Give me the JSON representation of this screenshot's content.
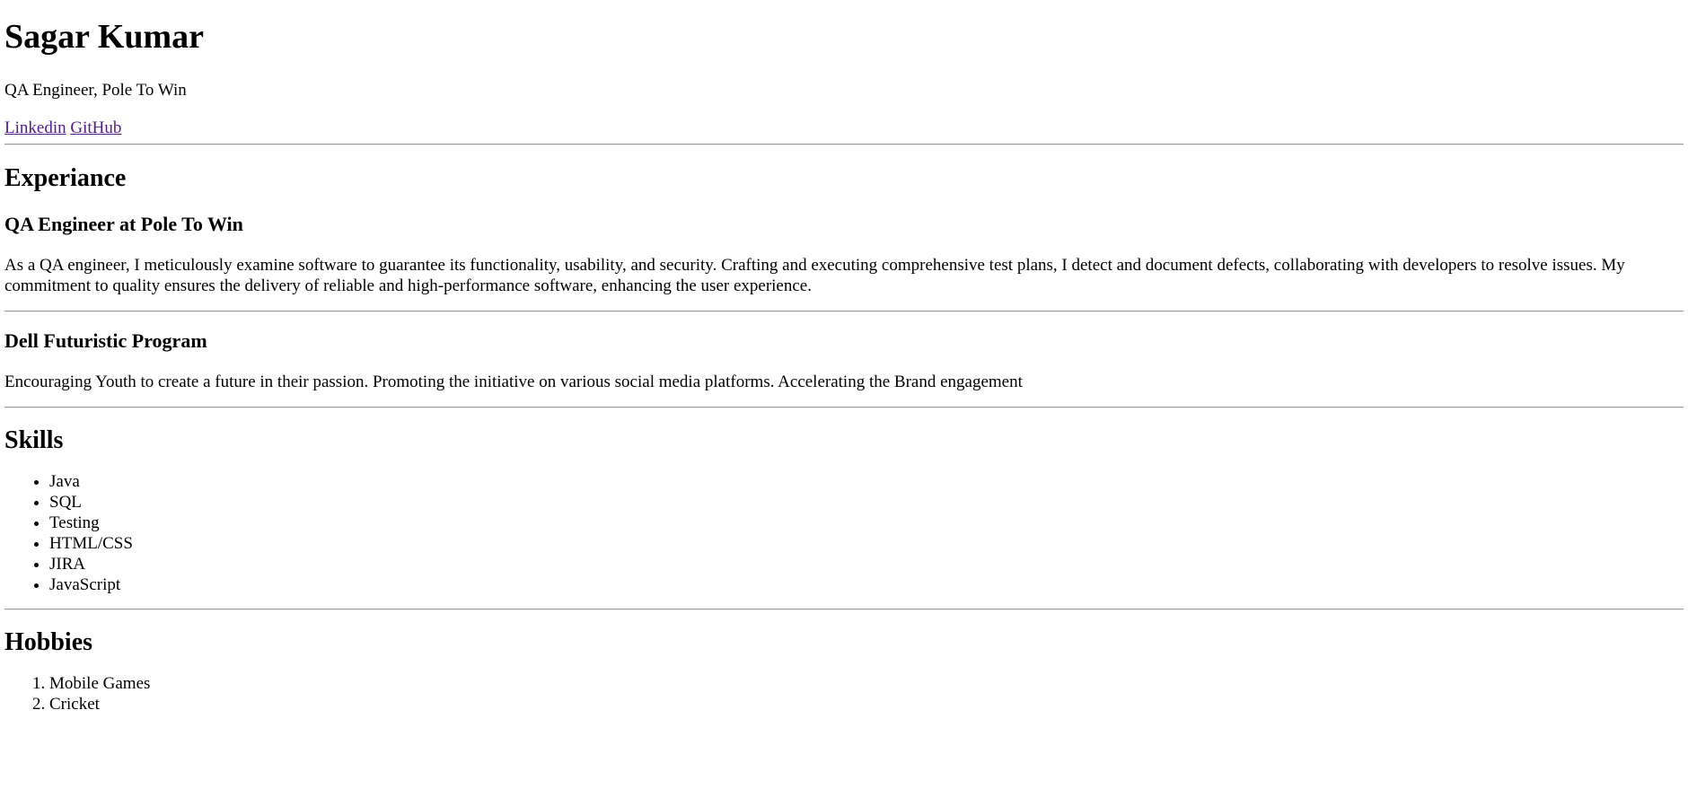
{
  "header": {
    "name": "Sagar Kumar",
    "subtitle": "QA Engineer, Pole To Win",
    "links": [
      {
        "label": "Linkedin"
      },
      {
        "label": "GitHub"
      }
    ]
  },
  "experience": {
    "heading": "Experiance",
    "entries": [
      {
        "title": "QA Engineer at Pole To Win",
        "description": "As a QA engineer, I meticulously examine software to guarantee its functionality, usability, and security. Crafting and executing comprehensive test plans, I detect and document defects, collaborating with developers to resolve issues. My commitment to quality ensures the delivery of reliable and high-performance software, enhancing the user experience."
      },
      {
        "title": "Dell Futuristic Program",
        "description": "Encouraging Youth to create a future in their passion. Promoting the initiative on various social media platforms. Accelerating the Brand engagement"
      }
    ]
  },
  "skills": {
    "heading": "Skills",
    "items": [
      "Java",
      "SQL",
      "Testing",
      "HTML/CSS",
      "JIRA",
      "JavaScript"
    ]
  },
  "hobbies": {
    "heading": "Hobbies",
    "items": [
      "Mobile Games",
      "Cricket"
    ]
  }
}
